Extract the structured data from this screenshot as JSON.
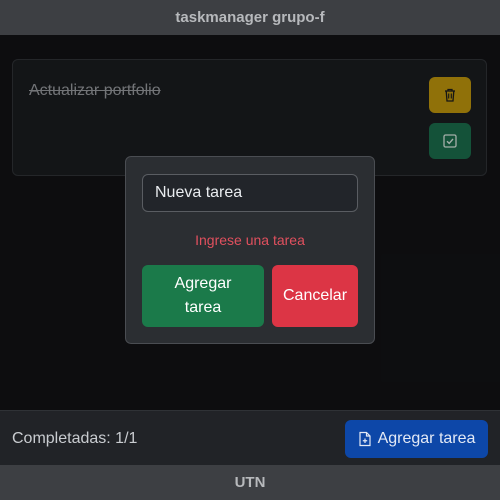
{
  "header": {
    "title": "taskmanager grupo-f"
  },
  "task": {
    "title": "Actualizar portfolio",
    "delete_icon": "trash-icon",
    "complete_icon": "check-square-icon"
  },
  "modal": {
    "input_placeholder": "Nueva tarea",
    "error": "Ingrese una tarea",
    "add_label": "Agregar tarea",
    "cancel_label": "Cancelar"
  },
  "footer": {
    "completed_text": "Completadas: 1/1",
    "add_button_label": "Agregar tarea",
    "add_button_icon": "file-plus-icon"
  },
  "bottom": {
    "text": "UTN"
  },
  "colors": {
    "warning": "#b08a0c",
    "success": "#196446",
    "danger": "#dc3545",
    "primary": "#0d47a8"
  }
}
